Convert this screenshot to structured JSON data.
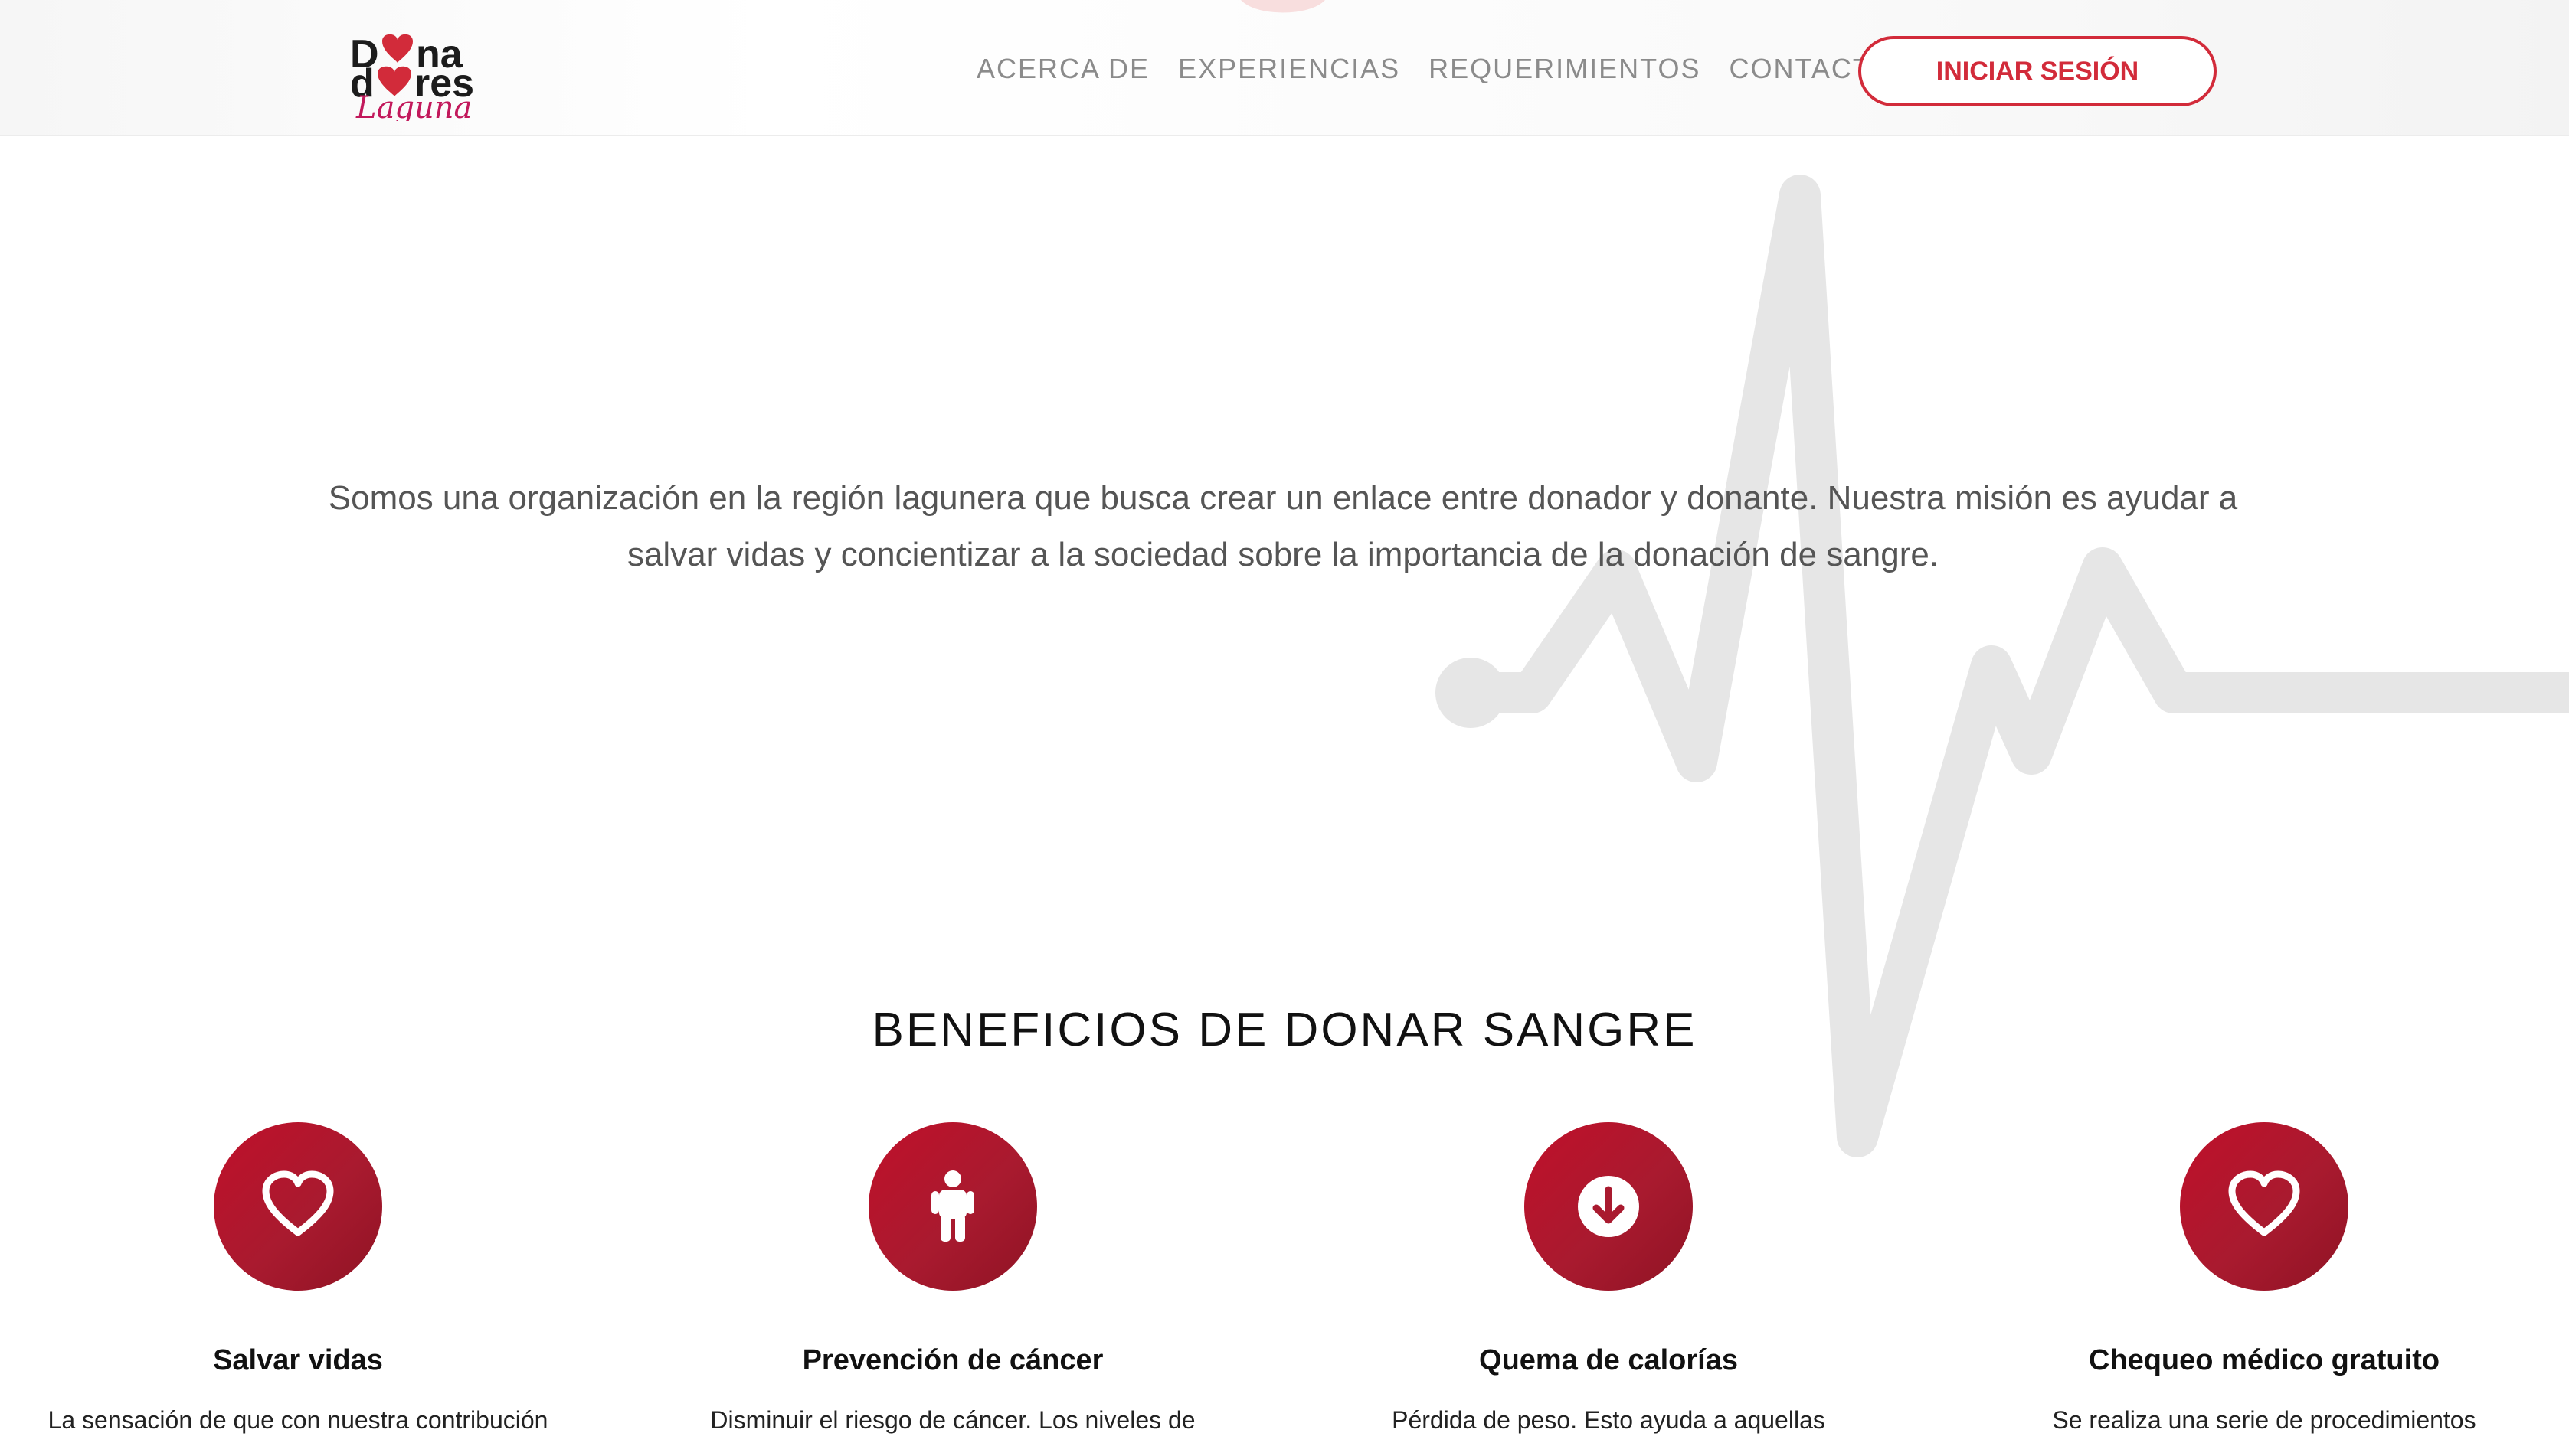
{
  "header": {
    "logo_text": "Donadores Laguna",
    "nav": [
      "ACERCA DE",
      "EXPERIENCIAS",
      "REQUERIMIENTOS",
      "CONTACTO"
    ],
    "login_label": "INICIAR SESIÓN"
  },
  "mission": {
    "text": "Somos una organización en la región lagunera que busca crear un enlace entre donador y donante. Nuestra misión es ayudar a salvar vidas y concientizar a la sociedad sobre la importancia de la donación de sangre."
  },
  "benefits": {
    "title": "BENEFICIOS DE DONAR SANGRE",
    "items": [
      {
        "icon": "heart-icon",
        "title": "Salvar vidas",
        "desc": "La sensación de que con nuestra contribución"
      },
      {
        "icon": "person-icon",
        "title": "Prevención de cáncer",
        "desc": "Disminuir el riesgo de cáncer. Los niveles de"
      },
      {
        "icon": "arrow-down-circle-icon",
        "title": "Quema de calorías",
        "desc": "Pérdida de peso. Esto ayuda a aquellas"
      },
      {
        "icon": "heart-icon",
        "title": "Chequeo médico gratuito",
        "desc": "Se realiza una serie de procedimientos"
      }
    ]
  },
  "colors": {
    "accent": "#d22b3a",
    "circle": "#a91a2f",
    "nav_text": "#8b8b8b",
    "heartbeat": "#e6e6e6"
  }
}
